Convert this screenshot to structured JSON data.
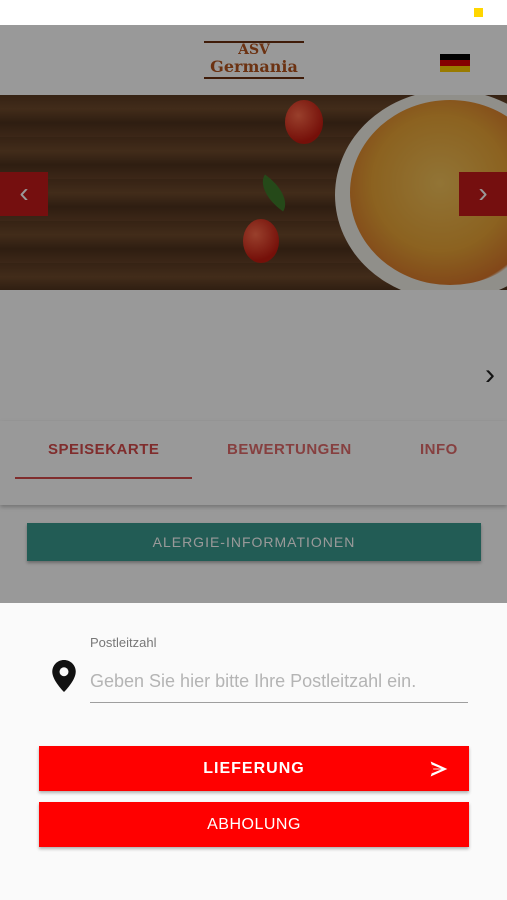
{
  "status_bar": {
    "indicator_color": "#ffd600"
  },
  "header": {
    "logo_line1": "ASV",
    "logo_line2": "Germania",
    "language_flag": "german-flag-icon",
    "flag_colors": [
      "#000000",
      "#dd0000",
      "#ffce00"
    ]
  },
  "hero": {
    "prev_label": "‹",
    "next_label": "›",
    "arrow_color": "#c41a1a"
  },
  "info_strip": {
    "chevron": "›"
  },
  "tabs": [
    {
      "label": "SPEISEKARTE",
      "active": true
    },
    {
      "label": "BEWERTUNGEN",
      "active": false
    },
    {
      "label": "INFO",
      "active": false
    }
  ],
  "allergy_button": {
    "label": "ALERGIE-INFORMATIONEN",
    "color": "#3a9a8e"
  },
  "sheet": {
    "zip_label": "Postleitzahl",
    "zip_placeholder": "Geben Sie hier bitte Ihre Postleitzahl ein.",
    "zip_value": "",
    "location_icon": "map-pin-icon",
    "delivery_label": "LIEFERUNG",
    "delivery_icon": "send-icon",
    "pickup_label": "ABHOLUNG",
    "button_color": "#ff0000"
  }
}
